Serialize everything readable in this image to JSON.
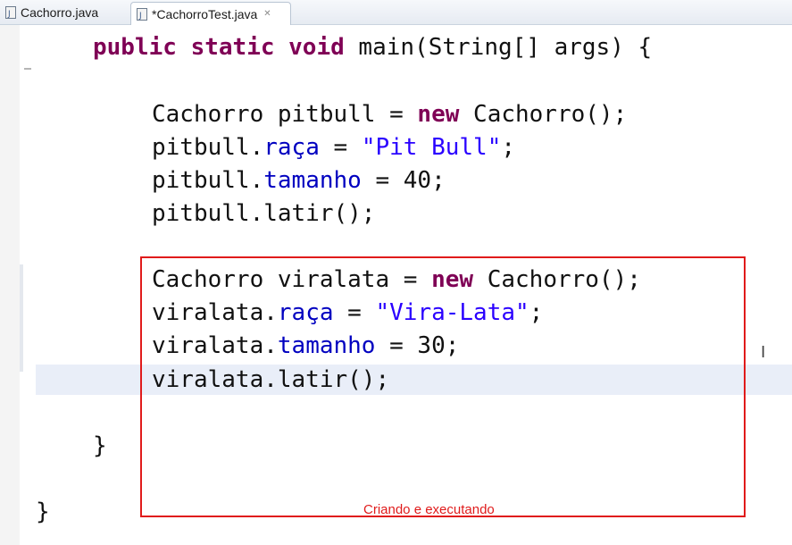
{
  "tabs": [
    {
      "label": "Cachorro.java",
      "active": false,
      "icon": "java-file-icon"
    },
    {
      "label": "*CachorroTest.java",
      "active": true,
      "icon": "java-file-icon",
      "close": "✕"
    }
  ],
  "colors": {
    "keyword": "#7f0055",
    "field": "#0000c0",
    "string": "#2a00ff",
    "annotation": "#e01b1b"
  },
  "code": {
    "main_kw1": "public",
    "main_kw2": "static",
    "main_kw3": "void",
    "main_sig": " main(String[] args) {",
    "p1_a": "Cachorro pitbull = ",
    "p1_new": "new",
    "p1_b": " Cachorro();",
    "p2_obj": "pitbull.",
    "p2_field": "raça",
    "p2_eq": " = ",
    "p2_str": "\"Pit Bull\"",
    "p2_end": ";",
    "p3_obj": "pitbull.",
    "p3_field": "tamanho",
    "p3_rest": " = 40;",
    "p4": "pitbull.latir();",
    "v1_a": "Cachorro viralata = ",
    "v1_new": "new",
    "v1_b": " Cachorro();",
    "v2_obj": "viralata.",
    "v2_field": "raça",
    "v2_eq": " = ",
    "v2_str": "\"Vira-Lata\"",
    "v2_end": ";",
    "v3_obj": "viralata.",
    "v3_field": "tamanho",
    "v3_rest": " = 30;",
    "v4": "viralata.latir();",
    "close_main": "}",
    "close_class": "}"
  },
  "annotation": {
    "caption": "Criando e executando"
  },
  "cursor": "I"
}
